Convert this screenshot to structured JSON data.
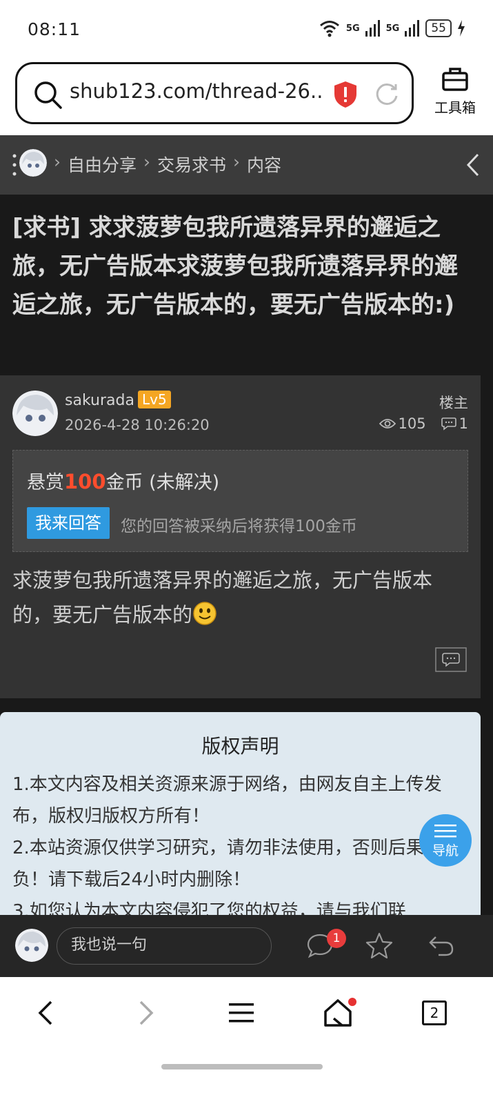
{
  "status_bar": {
    "time": "08:11",
    "signal_1": "5G",
    "signal_2": "5G",
    "battery": "55"
  },
  "browser": {
    "url": "shub123.com/thread-26...",
    "toolbox_label": "工具箱",
    "tab_count": "2"
  },
  "breadcrumb": {
    "items": [
      "自由分享",
      "交易求书",
      "内容"
    ],
    "separator": "›"
  },
  "thread": {
    "title": "[求书] 求求菠萝包我所遗落异界的邂逅之旅，无广告版本求菠萝包我所遗落异界的邂逅之旅，无广告版本的，要无广告版本的:)",
    "author": "sakurada",
    "level": "Lv5",
    "date": "2026-4-28 10:26:20",
    "role": "楼主",
    "views": "105",
    "replies": "1",
    "reward": {
      "prefix": "悬赏",
      "amount": "100",
      "suffix": "金币 (未解决)",
      "answer_button": "我来回答",
      "hint": "您的回答被采纳后将获得100金币"
    },
    "body": "求菠萝包我所遗落异界的邂逅之旅，无广告版本的，要无广告版本的"
  },
  "copyright": {
    "title": "版权声明",
    "lines": [
      "1.本文内容及相关资源来源于网络，由网友自主上传发布，版权归版权方所有！",
      "2.本站资源仅供学习研究，请勿非法使用，否则后果自负！请下载后24小时内删除！",
      "3.如您认为本文内容侵犯了您的权益，请与我们联"
    ]
  },
  "floating_nav": {
    "label": "导航"
  },
  "reply_bar": {
    "placeholder": "我也说一句",
    "comment_badge": "1"
  },
  "colors": {
    "accent_blue": "#2f9ae0",
    "level_orange": "#f5a623",
    "reward_red": "#ff4d2d",
    "badge_red": "#e83c3c"
  }
}
